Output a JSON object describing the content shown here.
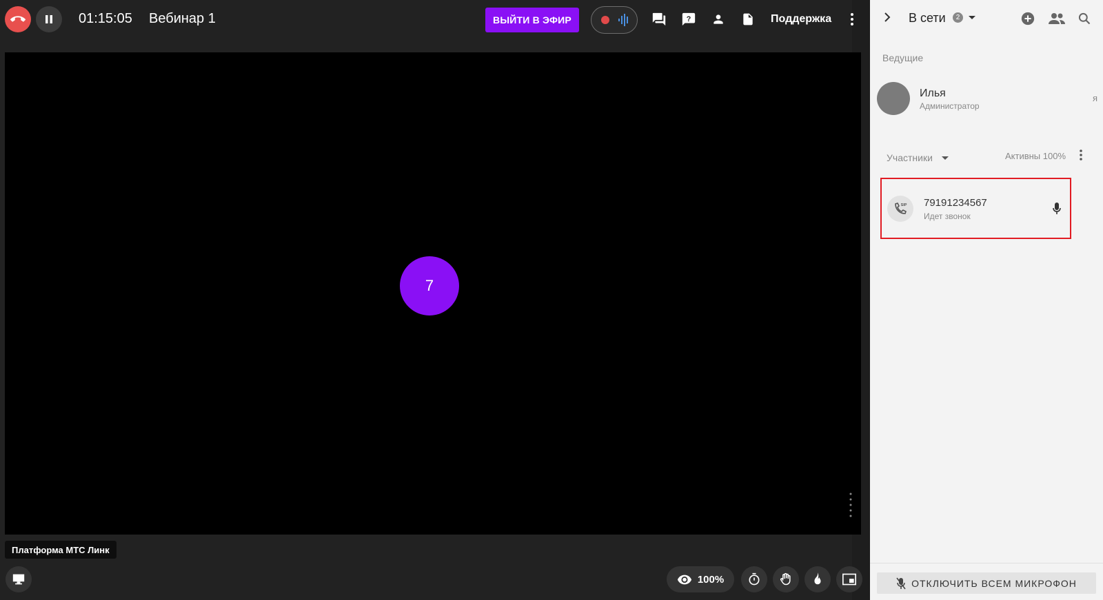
{
  "header": {
    "timer": "01:15:05",
    "title": "Вебинар 1",
    "go_live_label": "ВЫЙТИ В ЭФИР",
    "support_label": "Поддержка",
    "icons": [
      "end-call-icon",
      "pause-icon",
      "record-icon",
      "audio-wave-icon",
      "chat-icon",
      "question-icon",
      "person-icon",
      "document-icon",
      "more-vertical-icon"
    ]
  },
  "stage": {
    "speaker_avatar_text": "7",
    "platform_label": "Платформа МТС Линк",
    "views_percent": "100%"
  },
  "panel": {
    "title": "В сети",
    "online_count": "2",
    "hosts_label": "Ведущие",
    "host": {
      "name": "Илья",
      "role": "Администратор",
      "me": "я"
    },
    "participants_label": "Участники",
    "active_label": "Активны 100%",
    "participant": {
      "number": "79191234567",
      "status": "Идет звонок"
    },
    "mute_all_label": "ОТКЛЮЧИТЬ ВСЕМ МИКРОФОН"
  },
  "colors": {
    "accent": "#8a10f5",
    "end_call": "#e8504e",
    "record": "#e14a4a",
    "highlight_border": "#e11b22",
    "stage_bg": "#222222",
    "panel_bg": "#f3f3f3"
  }
}
